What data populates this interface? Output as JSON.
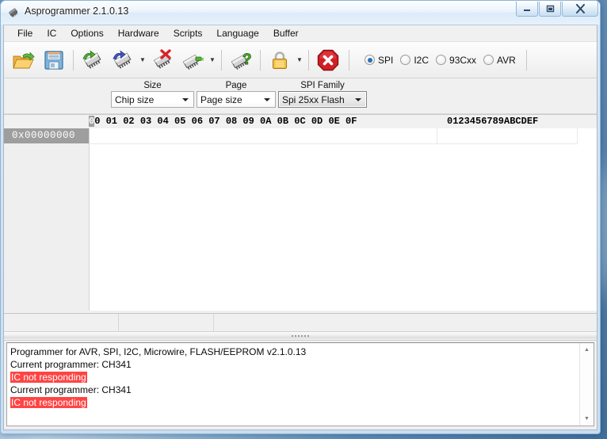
{
  "window": {
    "title": "Asprogrammer 2.1.0.13",
    "icon": "chip-icon",
    "caption_buttons": [
      {
        "name": "minimize",
        "glyph": "–"
      },
      {
        "name": "maximize",
        "glyph": "□"
      },
      {
        "name": "close",
        "glyph": "✕"
      }
    ]
  },
  "menubar": {
    "items": [
      {
        "label": "File"
      },
      {
        "label": "IC"
      },
      {
        "label": "Options"
      },
      {
        "label": "Hardware"
      },
      {
        "label": "Scripts"
      },
      {
        "label": "Language"
      },
      {
        "label": "Buffer"
      }
    ]
  },
  "toolbar": {
    "buttons": [
      {
        "name": "open-file-button",
        "icon": "open-folder-icon",
        "tip": "Open"
      },
      {
        "name": "save-file-button",
        "icon": "floppy-disk-icon",
        "tip": "Save"
      },
      {
        "name": "read-ic-button",
        "icon": "chip-read-icon",
        "tip": "Read IC"
      },
      {
        "name": "write-ic-button",
        "icon": "chip-write-icon",
        "tip": "Write IC"
      },
      {
        "name": "erase-ic-button",
        "icon": "chip-erase-icon",
        "tip": "Erase IC"
      },
      {
        "name": "verify-ic-button",
        "icon": "chip-verify-icon",
        "tip": "Verify IC"
      },
      {
        "name": "detect-ic-button",
        "icon": "chip-detect-icon",
        "tip": "Detect IC"
      },
      {
        "name": "lock-button",
        "icon": "padlock-icon",
        "tip": "Protection"
      },
      {
        "name": "stop-button",
        "icon": "stop-octagon-icon",
        "tip": "Stop"
      }
    ]
  },
  "protocol": {
    "options": [
      {
        "label": "SPI",
        "checked": true
      },
      {
        "label": "I2C",
        "checked": false
      },
      {
        "label": "93Cxx",
        "checked": false
      },
      {
        "label": "AVR",
        "checked": false
      }
    ]
  },
  "selectors": {
    "size": {
      "label": "Size",
      "value": "Chip size"
    },
    "page": {
      "label": "Page",
      "value": "Page size"
    },
    "family": {
      "label": "SPI Family",
      "value": "Spi 25xx Flash"
    }
  },
  "hexview": {
    "byte_headers": "00 01 02 03 04 05 06 07 08 09 0A 0B 0C 0D 0E 0F",
    "header_selected": "0",
    "header_rest": "0 01 02 03 04 05 06 07 08 09 0A 0B 0C 0D 0E 0F",
    "ascii_header": "0123456789ABCDEF",
    "rows": [
      {
        "address": "0x00000000",
        "bytes": "",
        "ascii": ""
      }
    ]
  },
  "statusbar": {
    "panes": [
      "",
      "",
      ""
    ]
  },
  "log": {
    "lines": [
      {
        "text": "Programmer for AVR, SPI, I2C, Microwire, FLASH/EEPROM v2.1.0.13",
        "error": false
      },
      {
        "text": "Current programmer: CH341",
        "error": false
      },
      {
        "text": "IC not responding",
        "error": true
      },
      {
        "text": "Current programmer: CH341",
        "error": false
      },
      {
        "text": "IC not responding",
        "error": true
      }
    ]
  },
  "colors": {
    "error_bg": "#ff4444",
    "accent": "#2a6fb5",
    "selection_gray": "#9e9e9e"
  }
}
